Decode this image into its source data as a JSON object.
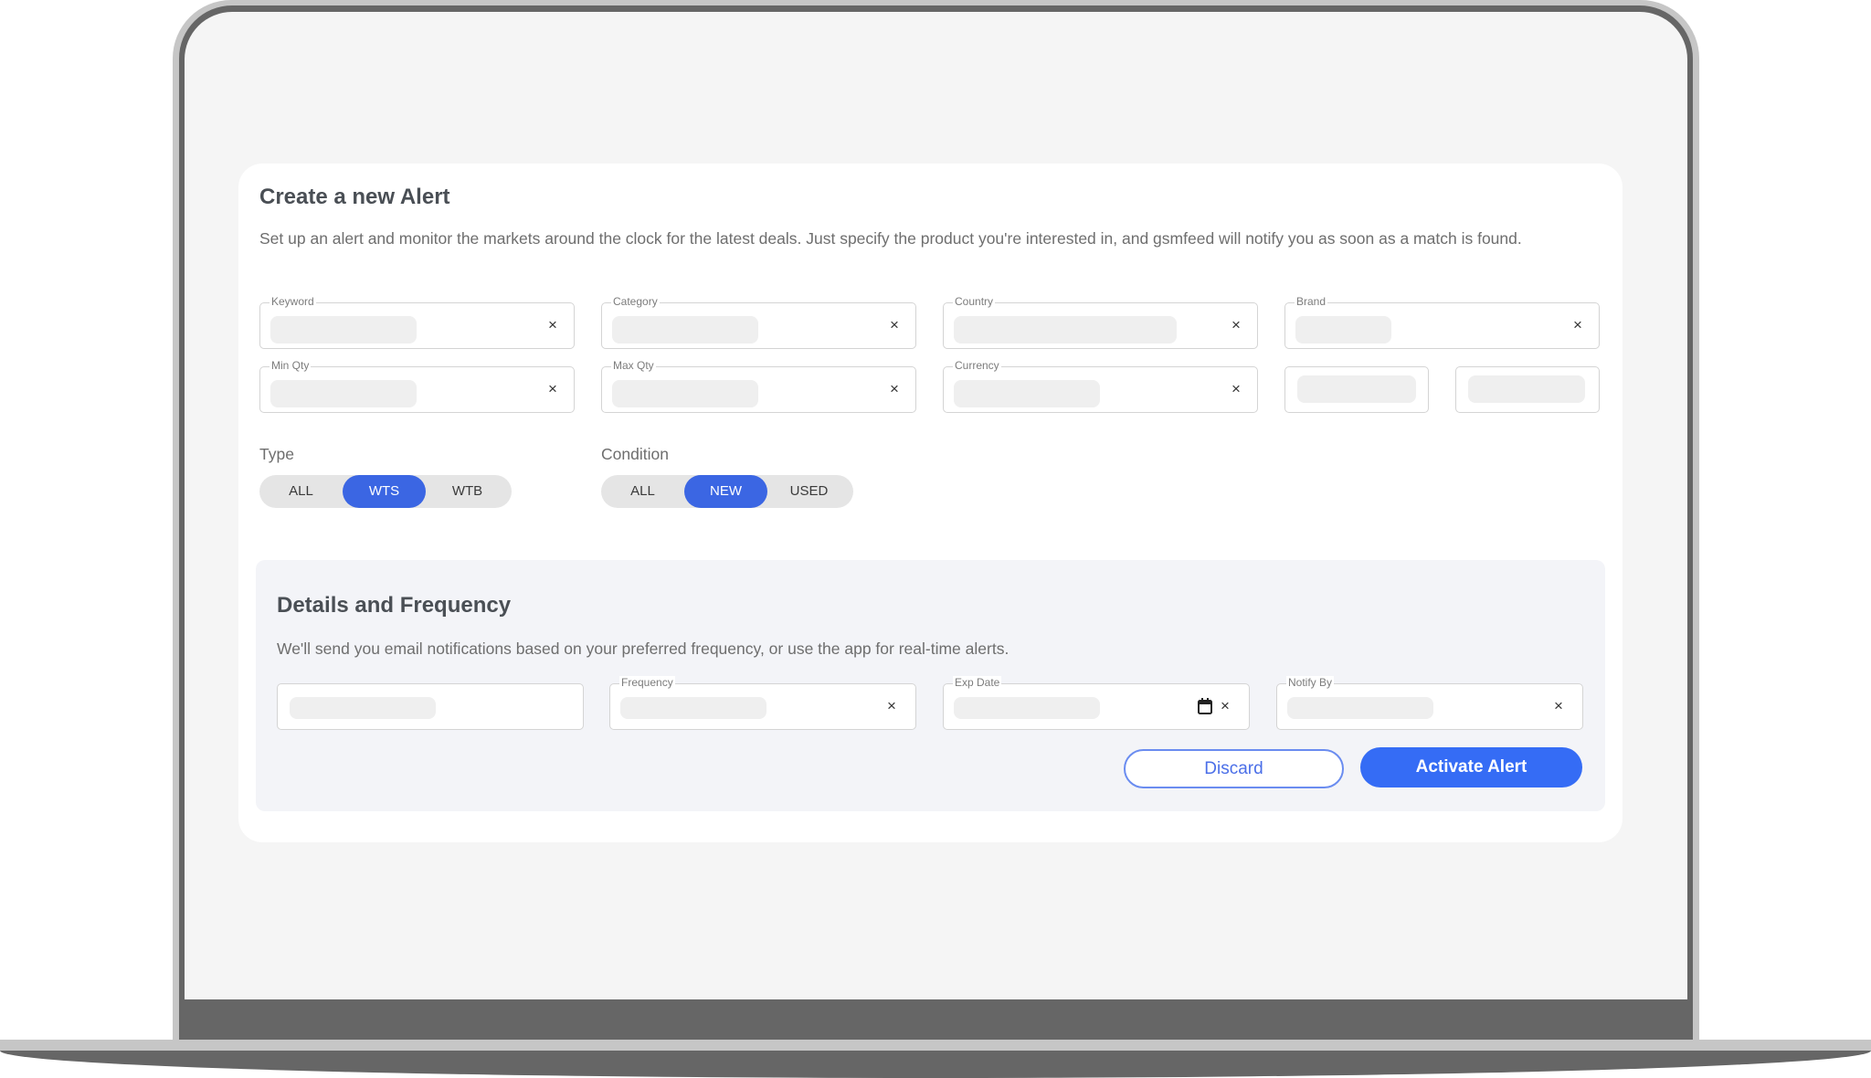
{
  "alert_form": {
    "title": "Create a new Alert",
    "description": "Set up an alert and monitor the markets around the clock for the latest deals. Just specify the product you're interested in, and gsmfeed will notify you as soon as a match is found.",
    "fields": {
      "keyword": {
        "label": "Keyword",
        "value": "",
        "clear_icon": "×"
      },
      "category": {
        "label": "Category",
        "value": "",
        "clear_icon": "×"
      },
      "country": {
        "label": "Country",
        "value": "",
        "clear_icon": "×"
      },
      "brand": {
        "label": "Brand",
        "value": "",
        "clear_icon": "×"
      },
      "min_qty": {
        "label": "Min Qty",
        "value": "",
        "clear_icon": "×"
      },
      "max_qty": {
        "label": "Max Qty",
        "value": "",
        "clear_icon": "×"
      },
      "currency": {
        "label": "Currency",
        "value": "",
        "clear_icon": "×"
      },
      "price_min": {
        "value": ""
      },
      "price_max": {
        "value": ""
      }
    },
    "type": {
      "label": "Type",
      "options": [
        "ALL",
        "WTS",
        "WTB"
      ],
      "selected": "WTS"
    },
    "condition": {
      "label": "Condition",
      "options": [
        "ALL",
        "NEW",
        "USED"
      ],
      "selected": "NEW"
    }
  },
  "details": {
    "title": "Details and Frequency",
    "description": "We'll send you email notifications based on your preferred frequency, or use the app for real-time alerts.",
    "fields": {
      "alert_name": {
        "value": ""
      },
      "frequency": {
        "label": "Frequency",
        "value": "",
        "clear_icon": "×"
      },
      "exp_date": {
        "label": "Exp Date",
        "value": "",
        "clear_icon": "×",
        "icon": "calendar-icon"
      },
      "notify_by": {
        "label": "Notify By",
        "value": "",
        "clear_icon": "×"
      }
    },
    "buttons": {
      "discard": "Discard",
      "activate": "Activate Alert"
    }
  },
  "colors": {
    "accent": "#3b66e3",
    "primary_button": "#356cf5",
    "discard_border": "#6a8cf0"
  }
}
